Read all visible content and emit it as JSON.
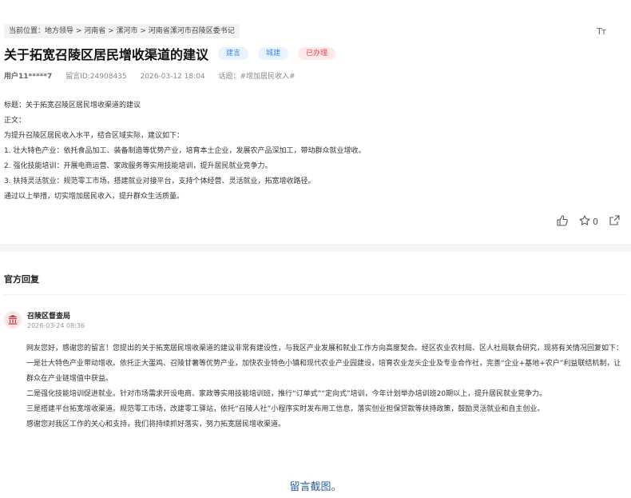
{
  "breadcrumb": "当前位置：地方领导 > 河南省 > 漯河市 > 河南省漯河市召陵区委书记",
  "font_size_icon": "Tт",
  "message": {
    "title": "关于拓宽召陵区居民增收渠道的建议",
    "tags": [
      "建言",
      "城建",
      "已办理"
    ],
    "user": "用户11*****7",
    "message_id": "留言ID:24908435",
    "time": "2026-03-12 18:04",
    "topic": "话题：#增加居民收入#",
    "body": [
      "标题：关于拓宽召陵区居民增收渠道的建议",
      "正文：",
      "为提升召陵区居民收入水平，结合区域实际，建议如下：",
      "1. 壮大特色产业：依托食品加工、装备制造等优势产业，培育本土企业，发展农产品深加工，带动群众就业增收。",
      "2. 强化技能培训：开展电商运营、家政服务等实用技能培训，提升居民就业竞争力。",
      "3. 扶持灵活就业：规范零工市场，搭建就业对接平台，支持个体经营、灵活就业，拓宽增收路径。",
      "通过以上举措，切实增加居民收入，提升群众生活质量。"
    ],
    "like_icon": "thumbs-up-icon",
    "star_count": "0",
    "share_icon": "share-icon"
  },
  "reply": {
    "section_title": "官方回复",
    "org_icon": "government-building-icon",
    "org_name": "召陵区督查局",
    "time": "2026-03-24 08:36",
    "paragraphs": [
      "网友您好，感谢您的留言！您提出的关于拓宽居民增收渠道的建议非常有建设性，与我区产业发展和就业工作方向高度契合。经区农业农村局、区人社局联合研究，现将有关情况回复如下：",
      "一是壮大特色产业带动增收。依托正大蛋鸡、召陵甘薯等优势产业，加快农业特色小镇和现代农业产业园建设，培育农业龙头企业及专业合作社，完善“企业+基地+农户”利益联结机制，让群众在产业链增值中获益。",
      "二是强化技能培训促进就业。针对市场需求开设电商、家政等实用技能培训班，推行“订单式”“定向式”培训，今年计划举办培训班20期以上，提升居民就业竞争力。",
      "三是搭建平台拓宽增收渠道。规范零工市场，改建零工驿站，依托“召陵人社”小程序实时发布用工信息，落实创业担保贷款等扶持政策，鼓励灵活就业和自主创业。",
      "感谢您对我区工作的关心和支持，我们将持续抓好落实，努力拓宽居民增收渠道。"
    ]
  },
  "caption": "留言截图。"
}
